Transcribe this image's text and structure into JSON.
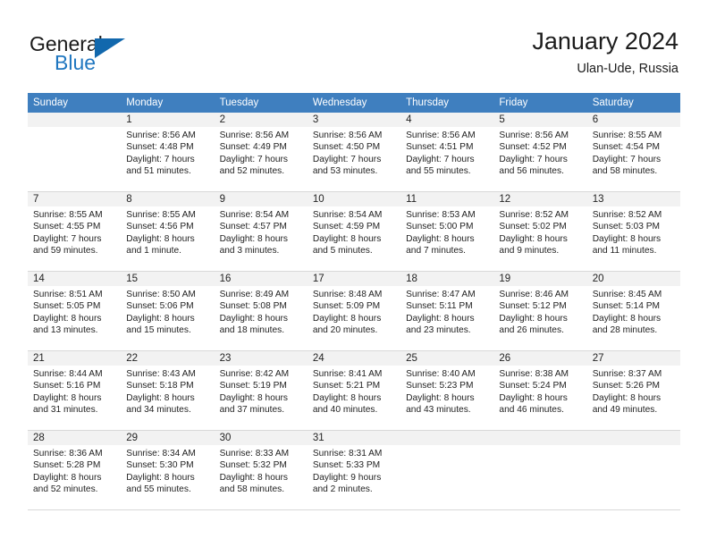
{
  "brand": {
    "name_top": "General",
    "name_bottom": "Blue",
    "flag_icon": "triangle-flag-icon",
    "color_top": "#1a1a1a",
    "color_bottom": "#2077c0",
    "flag_color": "#1268ad"
  },
  "header": {
    "title": "January 2024",
    "subtitle": "Ulan-Ude, Russia"
  },
  "theme": {
    "header_bg": "#3f7fbf",
    "header_text": "#ffffff",
    "daynum_band_bg": "#f2f2f2",
    "cell_border": "#d8d8d8",
    "text": "#1f1f1f"
  },
  "columns": [
    "Sunday",
    "Monday",
    "Tuesday",
    "Wednesday",
    "Thursday",
    "Friday",
    "Saturday"
  ],
  "weeks": [
    [
      {
        "day": "",
        "lines": []
      },
      {
        "day": "1",
        "lines": [
          "Sunrise: 8:56 AM",
          "Sunset: 4:48 PM",
          "Daylight: 7 hours",
          "and 51 minutes."
        ]
      },
      {
        "day": "2",
        "lines": [
          "Sunrise: 8:56 AM",
          "Sunset: 4:49 PM",
          "Daylight: 7 hours",
          "and 52 minutes."
        ]
      },
      {
        "day": "3",
        "lines": [
          "Sunrise: 8:56 AM",
          "Sunset: 4:50 PM",
          "Daylight: 7 hours",
          "and 53 minutes."
        ]
      },
      {
        "day": "4",
        "lines": [
          "Sunrise: 8:56 AM",
          "Sunset: 4:51 PM",
          "Daylight: 7 hours",
          "and 55 minutes."
        ]
      },
      {
        "day": "5",
        "lines": [
          "Sunrise: 8:56 AM",
          "Sunset: 4:52 PM",
          "Daylight: 7 hours",
          "and 56 minutes."
        ]
      },
      {
        "day": "6",
        "lines": [
          "Sunrise: 8:55 AM",
          "Sunset: 4:54 PM",
          "Daylight: 7 hours",
          "and 58 minutes."
        ]
      }
    ],
    [
      {
        "day": "7",
        "lines": [
          "Sunrise: 8:55 AM",
          "Sunset: 4:55 PM",
          "Daylight: 7 hours",
          "and 59 minutes."
        ]
      },
      {
        "day": "8",
        "lines": [
          "Sunrise: 8:55 AM",
          "Sunset: 4:56 PM",
          "Daylight: 8 hours",
          "and 1 minute."
        ]
      },
      {
        "day": "9",
        "lines": [
          "Sunrise: 8:54 AM",
          "Sunset: 4:57 PM",
          "Daylight: 8 hours",
          "and 3 minutes."
        ]
      },
      {
        "day": "10",
        "lines": [
          "Sunrise: 8:54 AM",
          "Sunset: 4:59 PM",
          "Daylight: 8 hours",
          "and 5 minutes."
        ]
      },
      {
        "day": "11",
        "lines": [
          "Sunrise: 8:53 AM",
          "Sunset: 5:00 PM",
          "Daylight: 8 hours",
          "and 7 minutes."
        ]
      },
      {
        "day": "12",
        "lines": [
          "Sunrise: 8:52 AM",
          "Sunset: 5:02 PM",
          "Daylight: 8 hours",
          "and 9 minutes."
        ]
      },
      {
        "day": "13",
        "lines": [
          "Sunrise: 8:52 AM",
          "Sunset: 5:03 PM",
          "Daylight: 8 hours",
          "and 11 minutes."
        ]
      }
    ],
    [
      {
        "day": "14",
        "lines": [
          "Sunrise: 8:51 AM",
          "Sunset: 5:05 PM",
          "Daylight: 8 hours",
          "and 13 minutes."
        ]
      },
      {
        "day": "15",
        "lines": [
          "Sunrise: 8:50 AM",
          "Sunset: 5:06 PM",
          "Daylight: 8 hours",
          "and 15 minutes."
        ]
      },
      {
        "day": "16",
        "lines": [
          "Sunrise: 8:49 AM",
          "Sunset: 5:08 PM",
          "Daylight: 8 hours",
          "and 18 minutes."
        ]
      },
      {
        "day": "17",
        "lines": [
          "Sunrise: 8:48 AM",
          "Sunset: 5:09 PM",
          "Daylight: 8 hours",
          "and 20 minutes."
        ]
      },
      {
        "day": "18",
        "lines": [
          "Sunrise: 8:47 AM",
          "Sunset: 5:11 PM",
          "Daylight: 8 hours",
          "and 23 minutes."
        ]
      },
      {
        "day": "19",
        "lines": [
          "Sunrise: 8:46 AM",
          "Sunset: 5:12 PM",
          "Daylight: 8 hours",
          "and 26 minutes."
        ]
      },
      {
        "day": "20",
        "lines": [
          "Sunrise: 8:45 AM",
          "Sunset: 5:14 PM",
          "Daylight: 8 hours",
          "and 28 minutes."
        ]
      }
    ],
    [
      {
        "day": "21",
        "lines": [
          "Sunrise: 8:44 AM",
          "Sunset: 5:16 PM",
          "Daylight: 8 hours",
          "and 31 minutes."
        ]
      },
      {
        "day": "22",
        "lines": [
          "Sunrise: 8:43 AM",
          "Sunset: 5:18 PM",
          "Daylight: 8 hours",
          "and 34 minutes."
        ]
      },
      {
        "day": "23",
        "lines": [
          "Sunrise: 8:42 AM",
          "Sunset: 5:19 PM",
          "Daylight: 8 hours",
          "and 37 minutes."
        ]
      },
      {
        "day": "24",
        "lines": [
          "Sunrise: 8:41 AM",
          "Sunset: 5:21 PM",
          "Daylight: 8 hours",
          "and 40 minutes."
        ]
      },
      {
        "day": "25",
        "lines": [
          "Sunrise: 8:40 AM",
          "Sunset: 5:23 PM",
          "Daylight: 8 hours",
          "and 43 minutes."
        ]
      },
      {
        "day": "26",
        "lines": [
          "Sunrise: 8:38 AM",
          "Sunset: 5:24 PM",
          "Daylight: 8 hours",
          "and 46 minutes."
        ]
      },
      {
        "day": "27",
        "lines": [
          "Sunrise: 8:37 AM",
          "Sunset: 5:26 PM",
          "Daylight: 8 hours",
          "and 49 minutes."
        ]
      }
    ],
    [
      {
        "day": "28",
        "lines": [
          "Sunrise: 8:36 AM",
          "Sunset: 5:28 PM",
          "Daylight: 8 hours",
          "and 52 minutes."
        ]
      },
      {
        "day": "29",
        "lines": [
          "Sunrise: 8:34 AM",
          "Sunset: 5:30 PM",
          "Daylight: 8 hours",
          "and 55 minutes."
        ]
      },
      {
        "day": "30",
        "lines": [
          "Sunrise: 8:33 AM",
          "Sunset: 5:32 PM",
          "Daylight: 8 hours",
          "and 58 minutes."
        ]
      },
      {
        "day": "31",
        "lines": [
          "Sunrise: 8:31 AM",
          "Sunset: 5:33 PM",
          "Daylight: 9 hours",
          "and 2 minutes."
        ]
      },
      {
        "day": "",
        "lines": []
      },
      {
        "day": "",
        "lines": []
      },
      {
        "day": "",
        "lines": []
      }
    ]
  ]
}
